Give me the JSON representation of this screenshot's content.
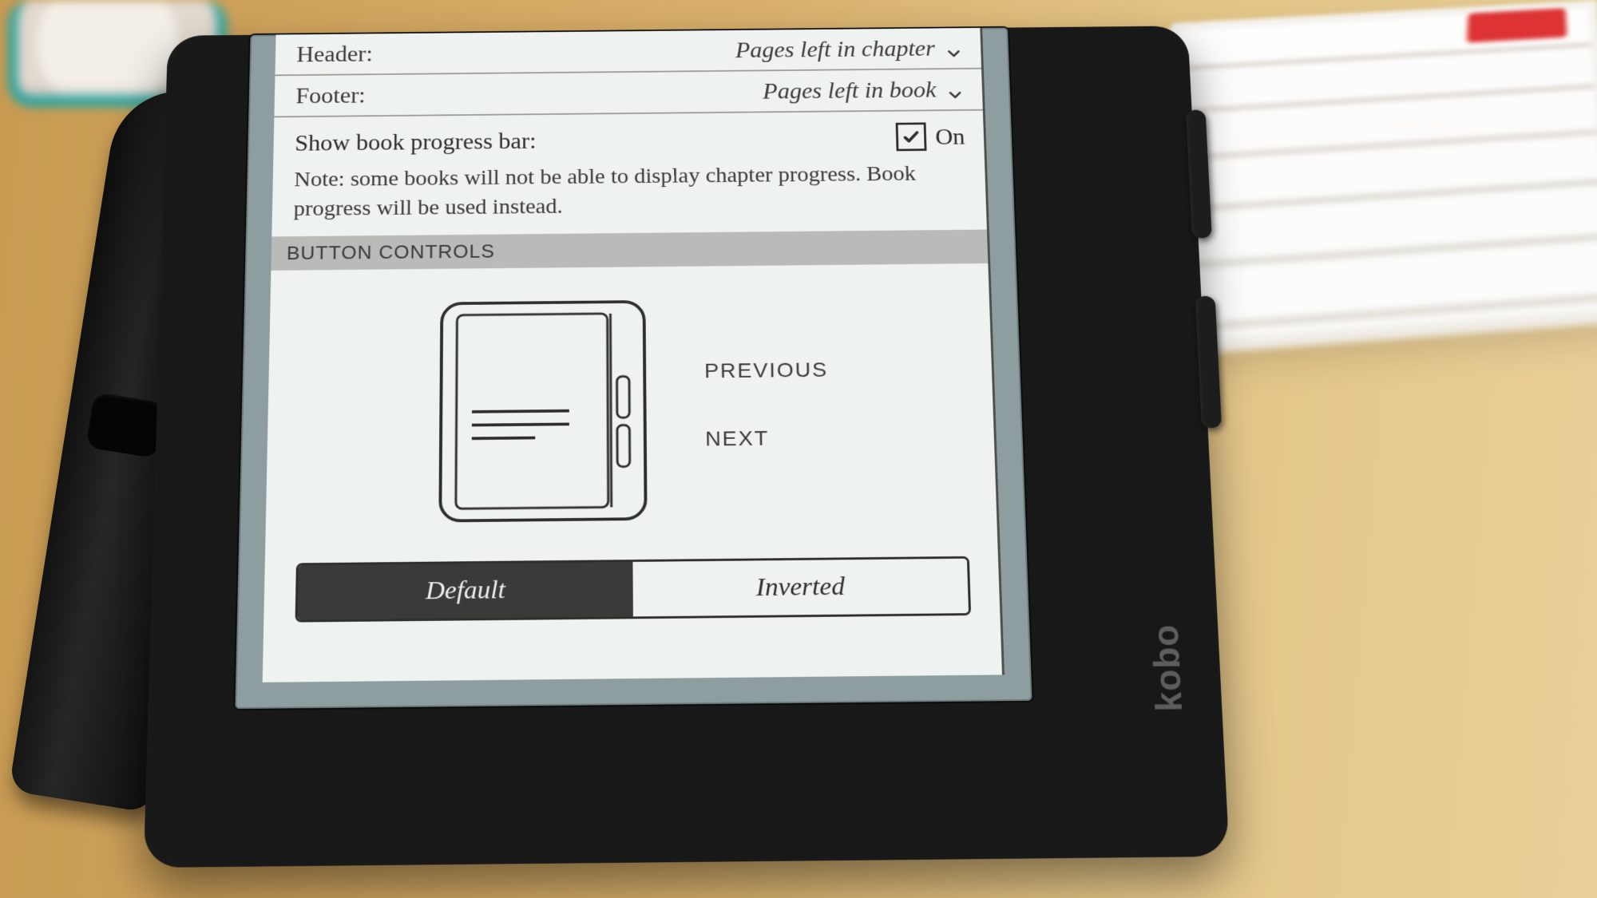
{
  "brand": "kobo",
  "settings": {
    "header": {
      "label": "Header:",
      "value": "Pages left in chapter"
    },
    "footer": {
      "label": "Footer:",
      "value": "Pages left in book"
    },
    "progress": {
      "label": "Show book progress bar:",
      "state_label": "On",
      "checked": true
    },
    "note": "Note: some books will not be able to display chapter progress. Book progress will be used instead."
  },
  "section": {
    "title": "BUTTON CONTROLS"
  },
  "button_controls": {
    "top_label": "PREVIOUS",
    "bottom_label": "NEXT",
    "options": {
      "default": "Default",
      "inverted": "Inverted"
    },
    "selected": "default"
  }
}
